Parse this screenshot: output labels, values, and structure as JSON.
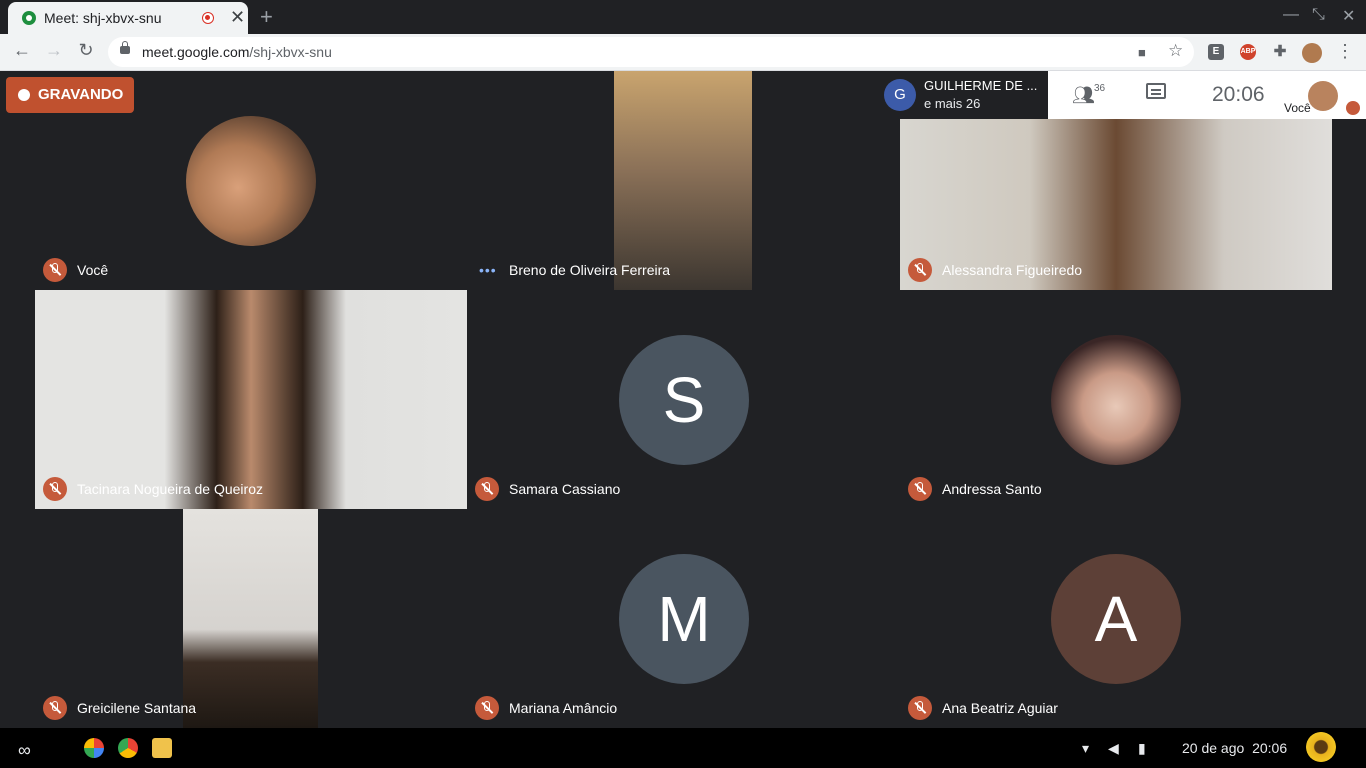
{
  "browser": {
    "tab_title": "Meet: shj-xbvx-snu",
    "tab_close": "✕",
    "new_tab": "+",
    "url_host": "meet.google.com",
    "url_path": "/shj-xbvx-snu",
    "extensions": [
      {
        "name": "E",
        "color": "#5f6368"
      },
      {
        "name": "ABP",
        "color": "#d0432c"
      }
    ]
  },
  "meet": {
    "recording_label": "GRAVANDO",
    "presenter": {
      "initial": "G",
      "name": "GUILHERME DE ...",
      "others": "e mais 26"
    },
    "participant_count": "36",
    "clock": "20:06",
    "self_label": "Você",
    "tiles": [
      {
        "name": "Você",
        "type": "avatar-photo",
        "muted": true
      },
      {
        "name": "Breno de Oliveira Ferreira",
        "type": "video",
        "muted": false
      },
      {
        "name": "Alessandra Figueiredo",
        "type": "video",
        "muted": true
      },
      {
        "name": "Tacinara Nogueira de Queiroz",
        "type": "video",
        "muted": true
      },
      {
        "name": "Samara Cassiano",
        "type": "letter",
        "letter": "S",
        "color": "#4a5560",
        "muted": true
      },
      {
        "name": "Andressa Santo",
        "type": "avatar-photo",
        "muted": true
      },
      {
        "name": "Greicilene Santana",
        "type": "video",
        "muted": true
      },
      {
        "name": "Mariana Amâncio",
        "type": "letter",
        "letter": "M",
        "color": "#4a5560",
        "muted": true
      },
      {
        "name": "Ana Beatriz Aguiar",
        "type": "letter",
        "letter": "A",
        "color": "#5d4037",
        "muted": true
      }
    ]
  },
  "taskbar": {
    "date": "20 de ago",
    "time": "20:06"
  },
  "colors": {
    "mute_badge": "#c55a3b",
    "recording": "#c0512f",
    "meet_bg": "#202124"
  }
}
